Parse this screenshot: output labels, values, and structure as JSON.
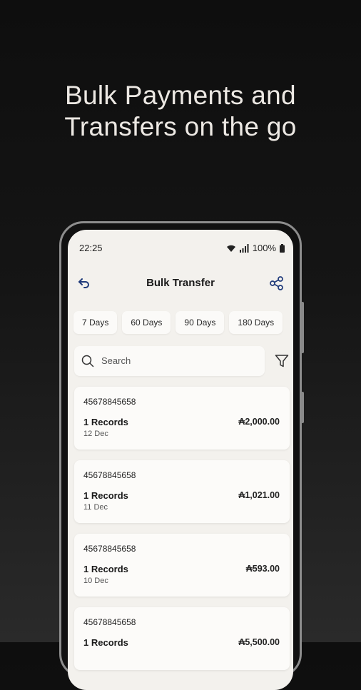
{
  "headline": {
    "line1": "Bulk Payments and",
    "line2": "Transfers on the go"
  },
  "status": {
    "time": "22:25",
    "battery": "100%"
  },
  "header": {
    "title": "Bulk Transfer"
  },
  "filters": {
    "chips": [
      "7 Days",
      "60 Days",
      "90 Days",
      "180 Days"
    ]
  },
  "search": {
    "placeholder": "Search"
  },
  "transactions": [
    {
      "ref": "45678845658",
      "records": "1 Records",
      "date": "12 Dec",
      "amount": "₳2,000.00"
    },
    {
      "ref": "45678845658",
      "records": "1 Records",
      "date": "11 Dec",
      "amount": "₳1,021.00"
    },
    {
      "ref": "45678845658",
      "records": "1 Records",
      "date": "10 Dec",
      "amount": "₳593.00"
    },
    {
      "ref": "45678845658",
      "records": "1 Records",
      "date": "",
      "amount": "₳5,500.00"
    }
  ],
  "icons": {
    "back": "back-arrow-icon",
    "share": "share-icon",
    "search": "search-icon",
    "filter": "filter-icon",
    "wifi": "wifi-icon",
    "signal": "signal-icon",
    "battery": "battery-icon"
  },
  "colors": {
    "background": "#111111",
    "screen": "#f3f1ed",
    "accent": "#1f3a7a",
    "text": "#1a1a1a"
  }
}
